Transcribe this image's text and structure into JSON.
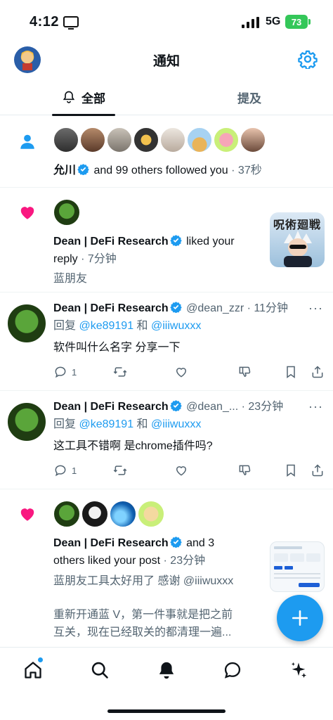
{
  "status_bar": {
    "time": "4:12",
    "network": "5G",
    "battery": "73"
  },
  "header": {
    "title": "通知"
  },
  "tabs": [
    {
      "label": "全部",
      "active": true
    },
    {
      "label": "提及",
      "active": false
    }
  ],
  "notifications": [
    {
      "kind": "follow",
      "name": "允川",
      "text": " and 99 others followed you",
      "time": " · 37秒"
    },
    {
      "kind": "like",
      "name": "Dean | DeFi Research",
      "text_1": " liked your",
      "text_2": "reply",
      "time": " · 7分钟",
      "quote": "蓝朋友",
      "thumb_text": "呪術廻戦"
    },
    {
      "kind": "reply",
      "name": "Dean | DeFi Research",
      "handle": " @dean_zzr",
      "time": " · 11分钟",
      "reply_prefix": "回复 ",
      "reply_user_1": "@ke89191",
      "reply_and": " 和 ",
      "reply_user_2": "@iiiwuxxx",
      "body": "软件叫什么名字  分享一下",
      "reply_count": "1"
    },
    {
      "kind": "reply",
      "name": "Dean | DeFi Research",
      "handle": " @dean_...",
      "time": " · 23分钟",
      "reply_prefix": "回复 ",
      "reply_user_1": "@ke89191",
      "reply_and": " 和 ",
      "reply_user_2": "@iiiwuxxx",
      "body": "这工具不错啊  是chrome插件吗?",
      "reply_count": "1"
    },
    {
      "kind": "like",
      "name": "Dean | DeFi Research",
      "text_1": " and 3",
      "text_2": "others liked your post",
      "time": " · 23分钟",
      "quote_line_1_a": "蓝朋友工具太好用了 感谢 ",
      "quote_line_1_b": "@iiiwuxxx",
      "quote_line_2": "重新开通蓝 V，第一件事就是把之前",
      "quote_line_3": "互关，现在已经取关的都清理一遍..."
    }
  ],
  "colors": {
    "accent": "#1d9bf0",
    "like": "#f91880",
    "text": "#0f1419",
    "muted": "#536471"
  },
  "icons": [
    "bell-icon",
    "gear-icon",
    "person-icon",
    "heart-icon",
    "reply-icon",
    "retweet-icon",
    "like-icon",
    "dislike-icon",
    "bookmark-icon",
    "share-icon",
    "home-icon",
    "search-icon",
    "notifications-icon",
    "messages-icon",
    "grok-icon",
    "compose-icon"
  ]
}
